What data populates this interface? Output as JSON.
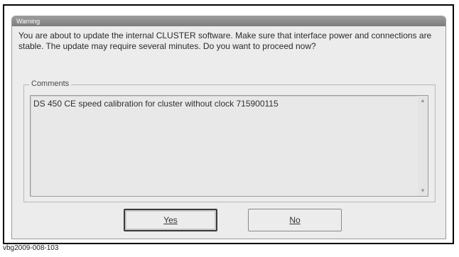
{
  "dialog": {
    "title": "Warning",
    "message": "You are about to update the internal CLUSTER software. Make sure that interface power and connections are stable. The update may require several minutes. Do you want to proceed now?",
    "comments_label": "Comments",
    "comments_text": "DS 450 CE speed calibration for cluster without clock 715900115",
    "yes_label": "Yes",
    "no_label": "No"
  },
  "scrollbar": {
    "up_icon": "chevron-up-icon",
    "down_icon": "chevron-down-icon"
  },
  "caption": "vbg2009-008-103"
}
